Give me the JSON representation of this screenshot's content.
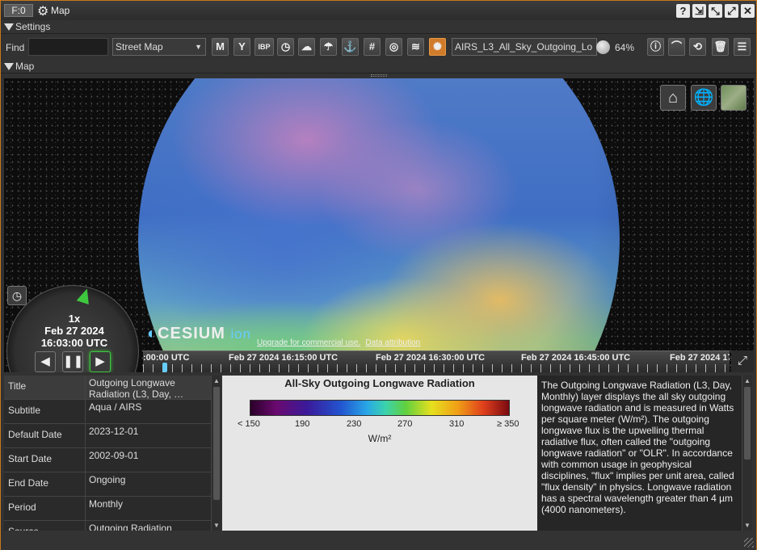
{
  "window": {
    "frame_label": "F:0",
    "title": "Map"
  },
  "sections": {
    "settings": "Settings",
    "map": "Map"
  },
  "toolbar": {
    "find_label": "Find",
    "find_value": "",
    "map_style": "Street Map",
    "buttons": [
      "M",
      "IBP"
    ],
    "layer": "AIRS_L3_All_Sky_Outgoing_Lo",
    "opacity": "64%"
  },
  "map": {
    "speed": "1x",
    "date": "Feb 27 2024",
    "time": "16:03:00 UTC",
    "brand": "CESIUM",
    "brand_suffix": "ion",
    "credit_upgrade": "Upgrade for commercial use.",
    "credit_attr": "Data attribution",
    "timeline": [
      ":00:00 UTC",
      "Feb 27 2024 16:15:00 UTC",
      "Feb 27 2024 16:30:00 UTC",
      "Feb 27 2024 16:45:00 UTC",
      "Feb 27 2024 17"
    ]
  },
  "properties": [
    {
      "key": "Title",
      "value": "Outgoing Longwave Radiation (L3, Day, …"
    },
    {
      "key": "Subtitle",
      "value": "Aqua / AIRS"
    },
    {
      "key": "Default Date",
      "value": "2023-12-01"
    },
    {
      "key": "Start Date",
      "value": "2002-09-01"
    },
    {
      "key": "End Date",
      "value": "Ongoing"
    },
    {
      "key": "Period",
      "value": "Monthly"
    },
    {
      "key": "Source",
      "value": "Outgoing Radiation"
    }
  ],
  "legend": {
    "title": "All-Sky Outgoing Longwave Radiation",
    "ticks": [
      "< 150",
      "190",
      "230",
      "270",
      "310",
      "≥ 350"
    ],
    "units": "W/m²"
  },
  "description": "The Outgoing Longwave Radiation (L3, Day, Monthly) layer displays the all sky outgoing longwave radiation and is measured in Watts per square meter (W/m²). The outgoing longwave flux is the upwelling thermal radiative flux, often called the \"outgoing longwave radiation\" or \"OLR\". In accordance with common usage in geophysical disciplines, \"flux\" implies per unit area, called \"flux density\" in physics. Longwave radiation has a spectral wavelength greater than 4 µm (4000 nanometers)."
}
